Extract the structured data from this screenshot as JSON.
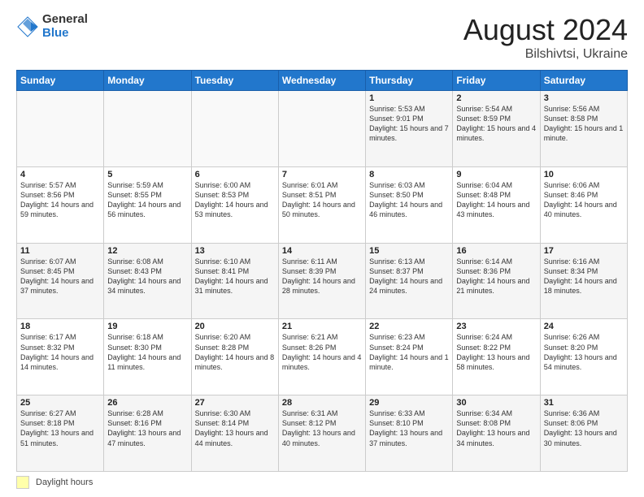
{
  "logo": {
    "general": "General",
    "blue": "Blue"
  },
  "header": {
    "month": "August 2024",
    "location": "Bilshivtsi, Ukraine"
  },
  "days_of_week": [
    "Sunday",
    "Monday",
    "Tuesday",
    "Wednesday",
    "Thursday",
    "Friday",
    "Saturday"
  ],
  "weeks": [
    [
      {
        "day": "",
        "sunrise": "",
        "sunset": "",
        "daylight": ""
      },
      {
        "day": "",
        "sunrise": "",
        "sunset": "",
        "daylight": ""
      },
      {
        "day": "",
        "sunrise": "",
        "sunset": "",
        "daylight": ""
      },
      {
        "day": "",
        "sunrise": "",
        "sunset": "",
        "daylight": ""
      },
      {
        "day": "1",
        "sunrise": "Sunrise: 5:53 AM",
        "sunset": "Sunset: 9:01 PM",
        "daylight": "Daylight: 15 hours and 7 minutes."
      },
      {
        "day": "2",
        "sunrise": "Sunrise: 5:54 AM",
        "sunset": "Sunset: 8:59 PM",
        "daylight": "Daylight: 15 hours and 4 minutes."
      },
      {
        "day": "3",
        "sunrise": "Sunrise: 5:56 AM",
        "sunset": "Sunset: 8:58 PM",
        "daylight": "Daylight: 15 hours and 1 minute."
      }
    ],
    [
      {
        "day": "4",
        "sunrise": "Sunrise: 5:57 AM",
        "sunset": "Sunset: 8:56 PM",
        "daylight": "Daylight: 14 hours and 59 minutes."
      },
      {
        "day": "5",
        "sunrise": "Sunrise: 5:59 AM",
        "sunset": "Sunset: 8:55 PM",
        "daylight": "Daylight: 14 hours and 56 minutes."
      },
      {
        "day": "6",
        "sunrise": "Sunrise: 6:00 AM",
        "sunset": "Sunset: 8:53 PM",
        "daylight": "Daylight: 14 hours and 53 minutes."
      },
      {
        "day": "7",
        "sunrise": "Sunrise: 6:01 AM",
        "sunset": "Sunset: 8:51 PM",
        "daylight": "Daylight: 14 hours and 50 minutes."
      },
      {
        "day": "8",
        "sunrise": "Sunrise: 6:03 AM",
        "sunset": "Sunset: 8:50 PM",
        "daylight": "Daylight: 14 hours and 46 minutes."
      },
      {
        "day": "9",
        "sunrise": "Sunrise: 6:04 AM",
        "sunset": "Sunset: 8:48 PM",
        "daylight": "Daylight: 14 hours and 43 minutes."
      },
      {
        "day": "10",
        "sunrise": "Sunrise: 6:06 AM",
        "sunset": "Sunset: 8:46 PM",
        "daylight": "Daylight: 14 hours and 40 minutes."
      }
    ],
    [
      {
        "day": "11",
        "sunrise": "Sunrise: 6:07 AM",
        "sunset": "Sunset: 8:45 PM",
        "daylight": "Daylight: 14 hours and 37 minutes."
      },
      {
        "day": "12",
        "sunrise": "Sunrise: 6:08 AM",
        "sunset": "Sunset: 8:43 PM",
        "daylight": "Daylight: 14 hours and 34 minutes."
      },
      {
        "day": "13",
        "sunrise": "Sunrise: 6:10 AM",
        "sunset": "Sunset: 8:41 PM",
        "daylight": "Daylight: 14 hours and 31 minutes."
      },
      {
        "day": "14",
        "sunrise": "Sunrise: 6:11 AM",
        "sunset": "Sunset: 8:39 PM",
        "daylight": "Daylight: 14 hours and 28 minutes."
      },
      {
        "day": "15",
        "sunrise": "Sunrise: 6:13 AM",
        "sunset": "Sunset: 8:37 PM",
        "daylight": "Daylight: 14 hours and 24 minutes."
      },
      {
        "day": "16",
        "sunrise": "Sunrise: 6:14 AM",
        "sunset": "Sunset: 8:36 PM",
        "daylight": "Daylight: 14 hours and 21 minutes."
      },
      {
        "day": "17",
        "sunrise": "Sunrise: 6:16 AM",
        "sunset": "Sunset: 8:34 PM",
        "daylight": "Daylight: 14 hours and 18 minutes."
      }
    ],
    [
      {
        "day": "18",
        "sunrise": "Sunrise: 6:17 AM",
        "sunset": "Sunset: 8:32 PM",
        "daylight": "Daylight: 14 hours and 14 minutes."
      },
      {
        "day": "19",
        "sunrise": "Sunrise: 6:18 AM",
        "sunset": "Sunset: 8:30 PM",
        "daylight": "Daylight: 14 hours and 11 minutes."
      },
      {
        "day": "20",
        "sunrise": "Sunrise: 6:20 AM",
        "sunset": "Sunset: 8:28 PM",
        "daylight": "Daylight: 14 hours and 8 minutes."
      },
      {
        "day": "21",
        "sunrise": "Sunrise: 6:21 AM",
        "sunset": "Sunset: 8:26 PM",
        "daylight": "Daylight: 14 hours and 4 minutes."
      },
      {
        "day": "22",
        "sunrise": "Sunrise: 6:23 AM",
        "sunset": "Sunset: 8:24 PM",
        "daylight": "Daylight: 14 hours and 1 minute."
      },
      {
        "day": "23",
        "sunrise": "Sunrise: 6:24 AM",
        "sunset": "Sunset: 8:22 PM",
        "daylight": "Daylight: 13 hours and 58 minutes."
      },
      {
        "day": "24",
        "sunrise": "Sunrise: 6:26 AM",
        "sunset": "Sunset: 8:20 PM",
        "daylight": "Daylight: 13 hours and 54 minutes."
      }
    ],
    [
      {
        "day": "25",
        "sunrise": "Sunrise: 6:27 AM",
        "sunset": "Sunset: 8:18 PM",
        "daylight": "Daylight: 13 hours and 51 minutes."
      },
      {
        "day": "26",
        "sunrise": "Sunrise: 6:28 AM",
        "sunset": "Sunset: 8:16 PM",
        "daylight": "Daylight: 13 hours and 47 minutes."
      },
      {
        "day": "27",
        "sunrise": "Sunrise: 6:30 AM",
        "sunset": "Sunset: 8:14 PM",
        "daylight": "Daylight: 13 hours and 44 minutes."
      },
      {
        "day": "28",
        "sunrise": "Sunrise: 6:31 AM",
        "sunset": "Sunset: 8:12 PM",
        "daylight": "Daylight: 13 hours and 40 minutes."
      },
      {
        "day": "29",
        "sunrise": "Sunrise: 6:33 AM",
        "sunset": "Sunset: 8:10 PM",
        "daylight": "Daylight: 13 hours and 37 minutes."
      },
      {
        "day": "30",
        "sunrise": "Sunrise: 6:34 AM",
        "sunset": "Sunset: 8:08 PM",
        "daylight": "Daylight: 13 hours and 34 minutes."
      },
      {
        "day": "31",
        "sunrise": "Sunrise: 6:36 AM",
        "sunset": "Sunset: 8:06 PM",
        "daylight": "Daylight: 13 hours and 30 minutes."
      }
    ]
  ],
  "footer": {
    "daylight_label": "Daylight hours"
  }
}
